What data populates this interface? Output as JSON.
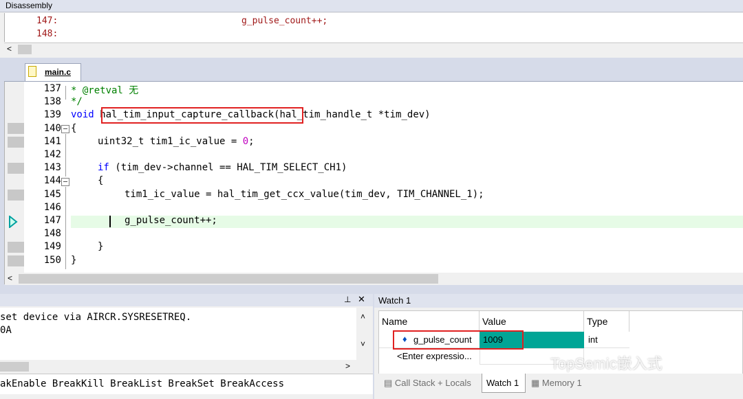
{
  "disassembly": {
    "title": "Disassembly",
    "lines": [
      {
        "addr": "147:",
        "code": "g_pulse_count++;"
      },
      {
        "addr": "148:",
        "code": ""
      }
    ]
  },
  "editor": {
    "file_tab": "main.c",
    "lines": [
      {
        "num": "137",
        "text": "* @retval 无"
      },
      {
        "num": "138",
        "text": "*/"
      },
      {
        "num": "139",
        "text": "void hal_tim_input_capture_callback(hal_tim_handle_t *tim_dev)"
      },
      {
        "num": "140",
        "text": "{"
      },
      {
        "num": "141",
        "text": "uint32_t tim1_ic_value = 0;"
      },
      {
        "num": "142",
        "text": ""
      },
      {
        "num": "143",
        "text": "if (tim_dev->channel == HAL_TIM_SELECT_CH1)"
      },
      {
        "num": "144",
        "text": "{"
      },
      {
        "num": "145",
        "text": "tim1_ic_value = hal_tim_get_ccx_value(tim_dev, TIM_CHANNEL_1);"
      },
      {
        "num": "146",
        "text": ""
      },
      {
        "num": "147",
        "text": "g_pulse_count++;"
      },
      {
        "num": "148",
        "text": ""
      },
      {
        "num": "149",
        "text": "}"
      },
      {
        "num": "150",
        "text": "}"
      }
    ],
    "highlighted_function": "hal_tim_input_capture_callback"
  },
  "command": {
    "output": [
      "set device via AIRCR.SYSRESETREQ.",
      "0A"
    ],
    "input_hint": "akEnable BreakKill BreakList BreakSet BreakAccess",
    "pin_icon": "pin-icon"
  },
  "watch": {
    "title": "Watch 1",
    "columns": [
      "Name",
      "Value",
      "Type"
    ],
    "rows": [
      {
        "name": "g_pulse_count",
        "value": "1009",
        "type": "int"
      },
      {
        "name": "<Enter expressio...",
        "value": "",
        "type": ""
      }
    ],
    "tabs": [
      "Call Stack + Locals",
      "Watch 1",
      "Memory 1"
    ],
    "active_tab": "Watch 1",
    "value_highlight": "#00a596"
  },
  "watermark": "TopSemic嵌入式"
}
